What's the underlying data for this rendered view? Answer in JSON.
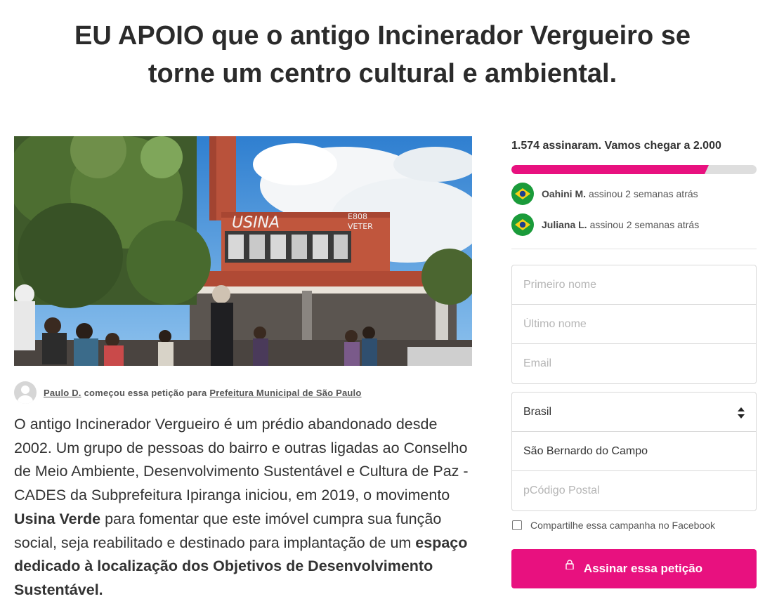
{
  "title": {
    "line1": "EU APOIO que o antigo Incinerador Vergueiro se",
    "line2": "torne um centro cultural e ambiental."
  },
  "hero": {
    "graffiti_main": "USINA",
    "graffiti_small1": "E808",
    "graffiti_small2": "VETER"
  },
  "starter": {
    "name": "Paulo D.",
    "middle": "começou essa petição para",
    "target": "Prefeitura Municipal de São Paulo"
  },
  "description": {
    "part1": "O antigo Incinerador Vergueiro é um prédio abandonado desde 2002. Um grupo de pessoas do bairro e outras ligadas ao Conselho de Meio Ambiente, Desenvolvimento Sustentável e Cultura de Paz - CADES da Subprefeitura Ipiranga iniciou, em 2019, o movimento ",
    "bold1": "Usina Verde",
    "part2": " para fomentar que este imóvel cumpra sua função social, seja reabilitado e destinado para implantação de um ",
    "bold2": "espaço dedicado à localização dos Objetivos de Desenvolvimento Sustentável."
  },
  "signatures": {
    "goal_text": "1.574 assinaram. Vamos chegar a 2.000",
    "progress_fraction": 0.787
  },
  "recent_signers": [
    {
      "name": "Oahini M.",
      "action": "assinou 2 semanas atrás",
      "flag_icon": "brazil-flag-icon"
    },
    {
      "name": "Juliana L.",
      "action": "assinou 2 semanas atrás",
      "flag_icon": "brazil-flag-icon"
    }
  ],
  "form": {
    "first_name_placeholder": "Primeiro nome",
    "last_name_placeholder": "Último nome",
    "email_placeholder": "Email",
    "country": "Brasil",
    "city": "São Bernardo do Campo",
    "postal_placeholder": "pCódigo Postal",
    "share_label": "Compartilhe essa campanha no Facebook",
    "submit_label": "Assinar essa petição"
  },
  "colors": {
    "accent": "#e8117f",
    "progress_track": "#dedede"
  }
}
